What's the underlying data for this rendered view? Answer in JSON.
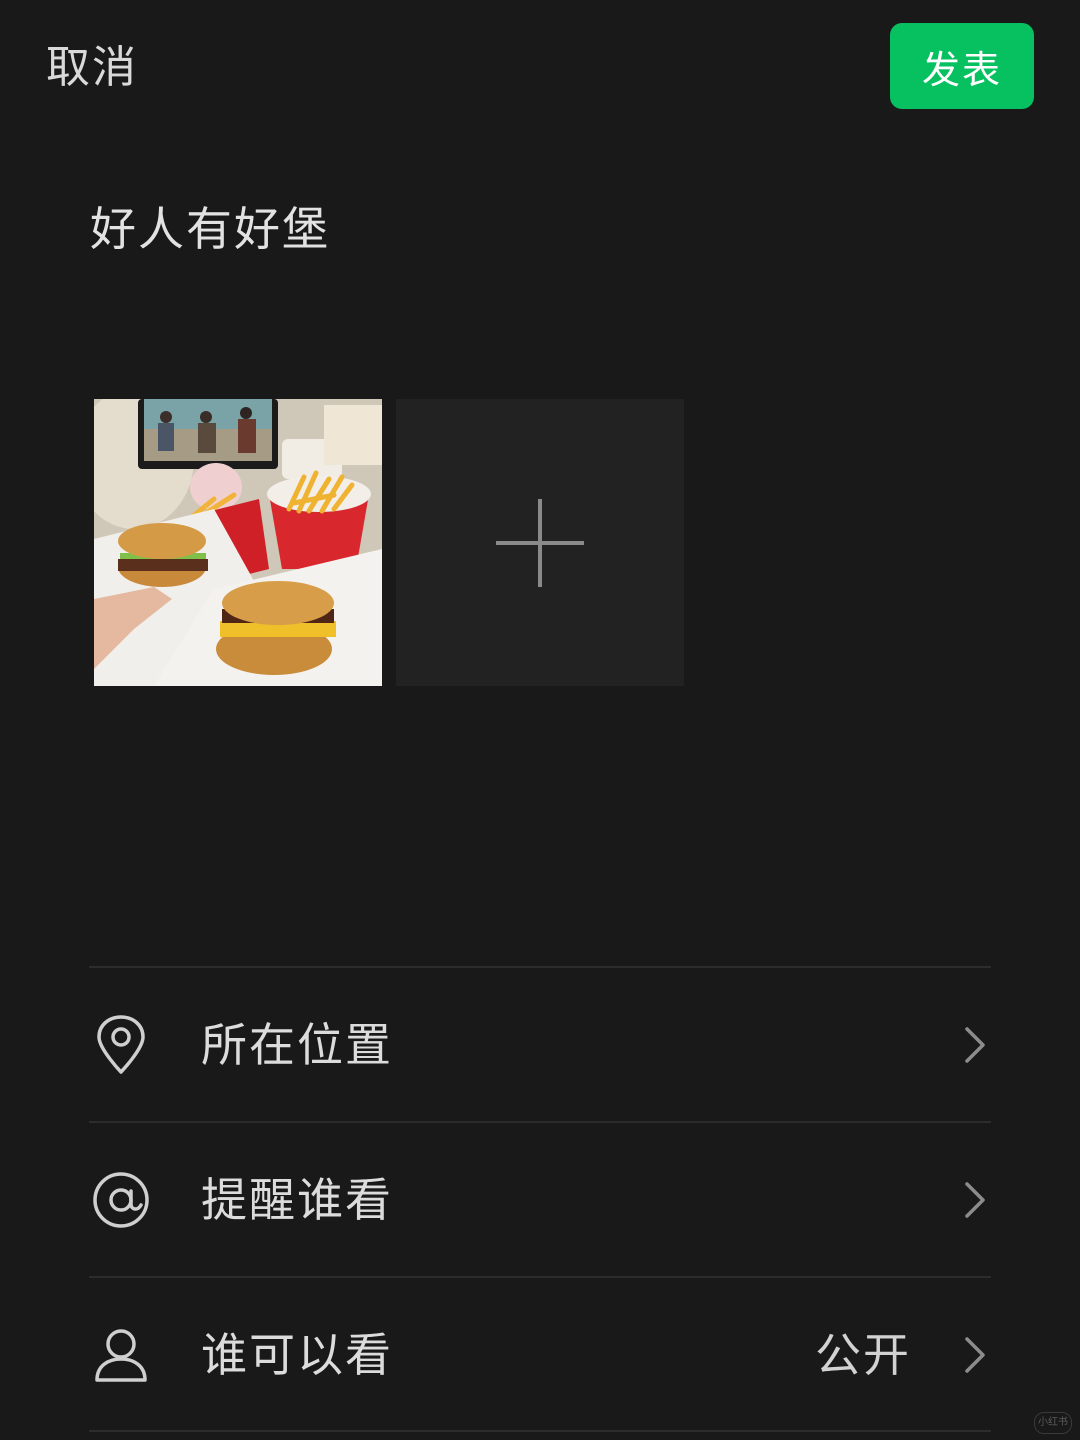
{
  "header": {
    "cancel_label": "取消",
    "publish_label": "发表"
  },
  "post": {
    "text": "好人有好堡"
  },
  "media": {
    "photo_alt": "burger-photo",
    "add_icon": "plus-icon"
  },
  "options": [
    {
      "icon": "location-pin-icon",
      "label": "所在位置",
      "value": ""
    },
    {
      "icon": "at-sign-icon",
      "label": "提醒谁看",
      "value": ""
    },
    {
      "icon": "person-icon",
      "label": "谁可以看",
      "value": "公开"
    }
  ],
  "watermark": {
    "text": "小红书"
  },
  "colors": {
    "accent": "#07c160",
    "background": "#191919",
    "tile": "#222222",
    "divider": "#2c2c2c"
  }
}
